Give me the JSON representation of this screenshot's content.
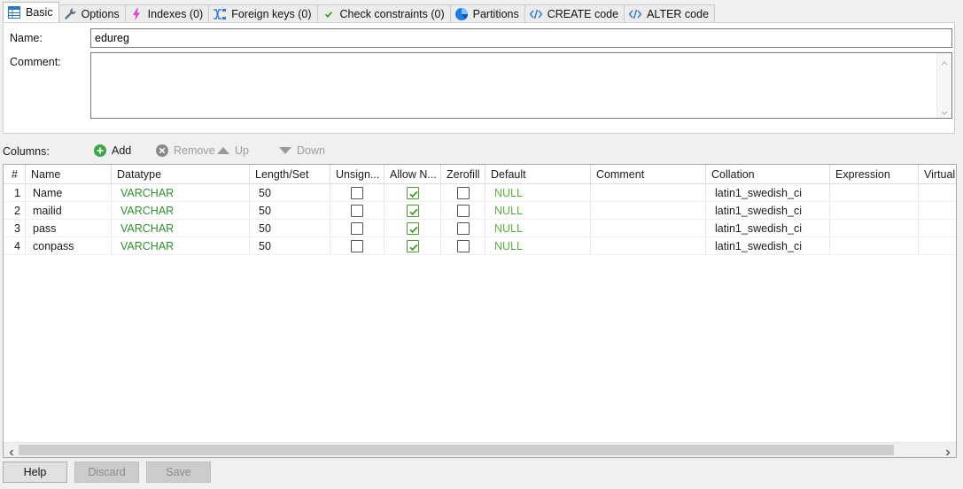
{
  "tabs": [
    {
      "label": "Basic",
      "icon": "table-icon"
    },
    {
      "label": "Options",
      "icon": "wrench-icon"
    },
    {
      "label": "Indexes (0)",
      "icon": "lightning-icon"
    },
    {
      "label": "Foreign keys (0)",
      "icon": "foreign-key-icon"
    },
    {
      "label": "Check constraints (0)",
      "icon": "check-icon"
    },
    {
      "label": "Partitions",
      "icon": "pie-icon"
    },
    {
      "label": "CREATE code",
      "icon": "code-icon"
    },
    {
      "label": "ALTER code",
      "icon": "code-icon"
    }
  ],
  "basic": {
    "name_label": "Name:",
    "name_value": "edureg",
    "comment_label": "Comment:",
    "comment_value": ""
  },
  "columns_toolbar": {
    "title": "Columns:",
    "add": "Add",
    "remove": "Remove",
    "up": "Up",
    "down": "Down"
  },
  "grid": {
    "headers": [
      "#",
      "Name",
      "Datatype",
      "Length/Set",
      "Unsign...",
      "Allow N...",
      "Zerofill",
      "Default",
      "Comment",
      "Collation",
      "Expression",
      "Virtuali"
    ],
    "rows": [
      {
        "num": "1",
        "name": "Name",
        "datatype": "VARCHAR",
        "length": "50",
        "unsigned": false,
        "allow_null": true,
        "zerofill": false,
        "default": "NULL",
        "comment": "",
        "collation": "latin1_swedish_ci",
        "expression": "",
        "virtuality": ""
      },
      {
        "num": "2",
        "name": "mailid",
        "datatype": "VARCHAR",
        "length": "50",
        "unsigned": false,
        "allow_null": true,
        "zerofill": false,
        "default": "NULL",
        "comment": "",
        "collation": "latin1_swedish_ci",
        "expression": "",
        "virtuality": ""
      },
      {
        "num": "3",
        "name": "pass",
        "datatype": "VARCHAR",
        "length": "50",
        "unsigned": false,
        "allow_null": true,
        "zerofill": false,
        "default": "NULL",
        "comment": "",
        "collation": "latin1_swedish_ci",
        "expression": "",
        "virtuality": ""
      },
      {
        "num": "4",
        "name": "conpass",
        "datatype": "VARCHAR",
        "length": "50",
        "unsigned": false,
        "allow_null": true,
        "zerofill": false,
        "default": "NULL",
        "comment": "",
        "collation": "latin1_swedish_ci",
        "expression": "",
        "virtuality": ""
      }
    ]
  },
  "buttons": {
    "help": "Help",
    "discard": "Discard",
    "save": "Save"
  },
  "colors": {
    "datatype_green": "#2f8f2f",
    "null_green": "#5aae3a",
    "check_green": "#4a9b2e"
  }
}
